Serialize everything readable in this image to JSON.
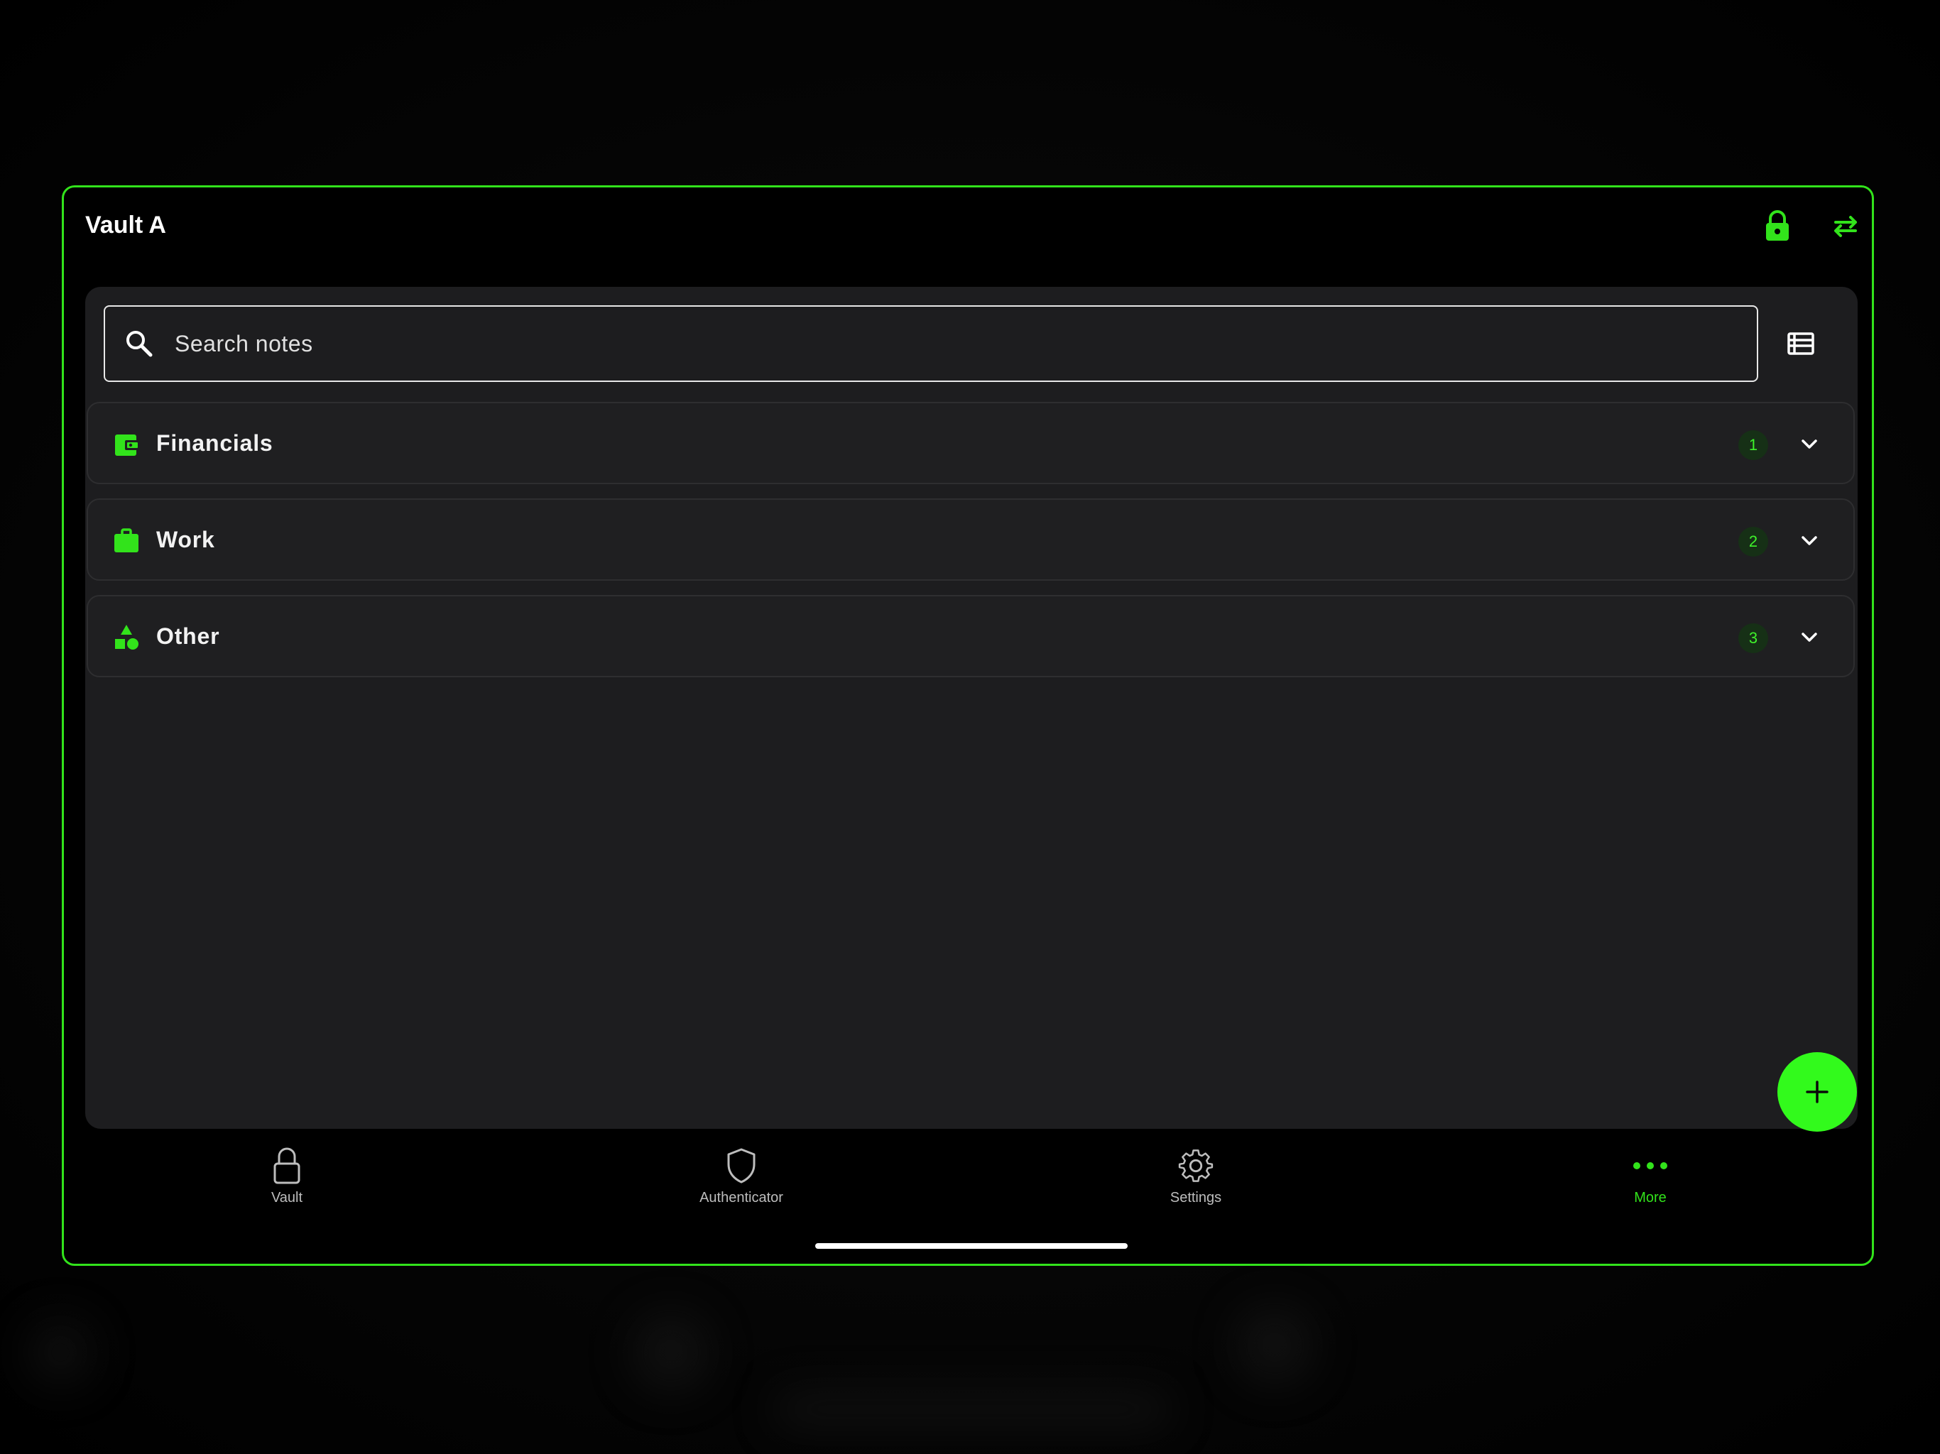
{
  "colors": {
    "accent": "#32e31b",
    "fab": "#32fa1c",
    "panel": "#1d1d1f",
    "nav_inactive": "#bdbdbd"
  },
  "header": {
    "title": "Vault A",
    "lock_icon": "lock-icon",
    "switch_icon": "swap-arrows-icon"
  },
  "search": {
    "placeholder": "Search notes",
    "value": ""
  },
  "categories": [
    {
      "label": "Financials",
      "count": "1",
      "icon": "wallet-icon"
    },
    {
      "label": "Work",
      "count": "2",
      "icon": "briefcase-icon"
    },
    {
      "label": "Other",
      "count": "3",
      "icon": "shapes-icon"
    }
  ],
  "fab": {
    "icon": "plus-icon"
  },
  "nav": {
    "items": [
      {
        "label": "Vault",
        "icon": "lock-outline-icon",
        "active": false
      },
      {
        "label": "Authenticator",
        "icon": "shield-icon",
        "active": false
      },
      {
        "label": "Settings",
        "icon": "gear-icon",
        "active": false
      },
      {
        "label": "More",
        "icon": "more-dots-icon",
        "active": true
      }
    ]
  }
}
